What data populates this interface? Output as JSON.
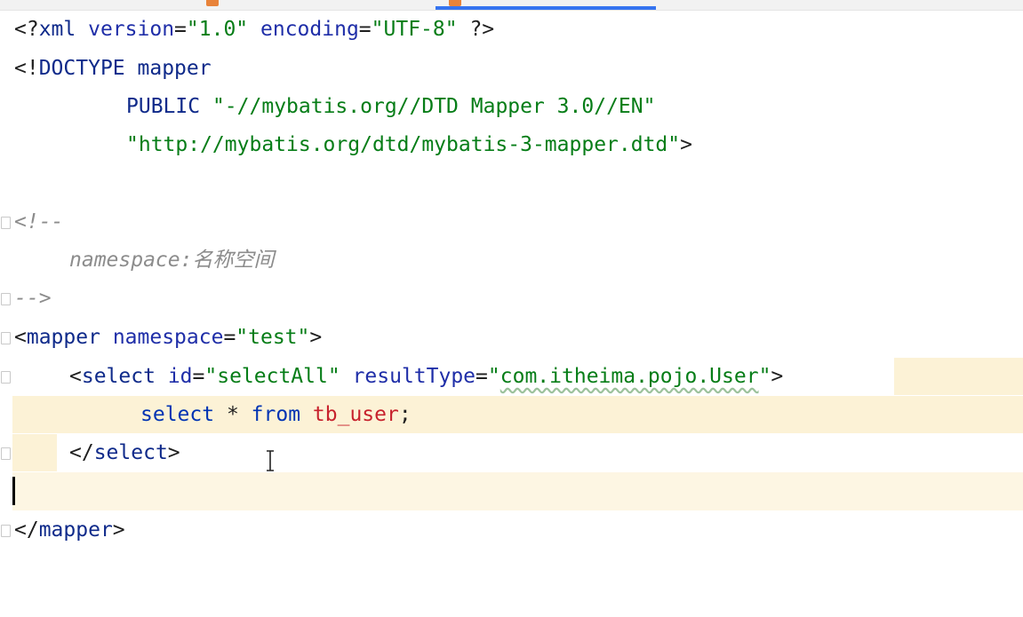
{
  "editor": {
    "lines": {
      "xml_decl": {
        "open": "<?",
        "name": "xml",
        "a1_name": "version",
        "a1_eq": "=",
        "a1_val": "\"1.0\"",
        "a2_name": "encoding",
        "a2_eq": "=",
        "a2_val": "\"UTF-8\"",
        "close": "?>"
      },
      "doctype": {
        "open": "<!",
        "name": "DOCTYPE",
        "root": "mapper"
      },
      "public_id": {
        "kw": "PUBLIC",
        "val": "\"-//mybatis.org//DTD Mapper 3.0//EN\""
      },
      "system_id": {
        "val": "\"http://mybatis.org/dtd/mybatis-3-mapper.dtd\"",
        "close": ">"
      },
      "comment_open": "<!--",
      "comment_body": "namespace:名称空间",
      "comment_close": "-->",
      "mapper_open": {
        "open": "<",
        "name": "mapper",
        "a_name": "namespace",
        "a_eq": "=",
        "a_val": "\"test\"",
        "close": ">"
      },
      "select_open": {
        "open": "<",
        "name": "select",
        "a1_name": "id",
        "a1_eq": "=",
        "a1_val": "\"selectAll\"",
        "a2_name": "resultType",
        "a2_eq": "=",
        "a2_val_q1": "\"",
        "a2_val": "com.itheima.pojo.User",
        "a2_val_q2": "\"",
        "close": ">"
      },
      "sql": {
        "kw1": "select",
        "star": "*",
        "kw2": "from",
        "table": "tb_user",
        "semi": ";"
      },
      "select_close": {
        "open": "</",
        "name": "select",
        "close": ">"
      },
      "mapper_close": {
        "open": "</",
        "name": "mapper",
        "close": ">"
      }
    }
  },
  "colors": {
    "tag": "#0f2a8a",
    "attribute": "#1f2ea8",
    "string": "#067d17",
    "comment": "#8c8c8c",
    "sql_keyword": "#0033b3",
    "sql_table": "#c7222d",
    "highlight": "#fcf2d6",
    "active_tab": "#3574f0"
  }
}
